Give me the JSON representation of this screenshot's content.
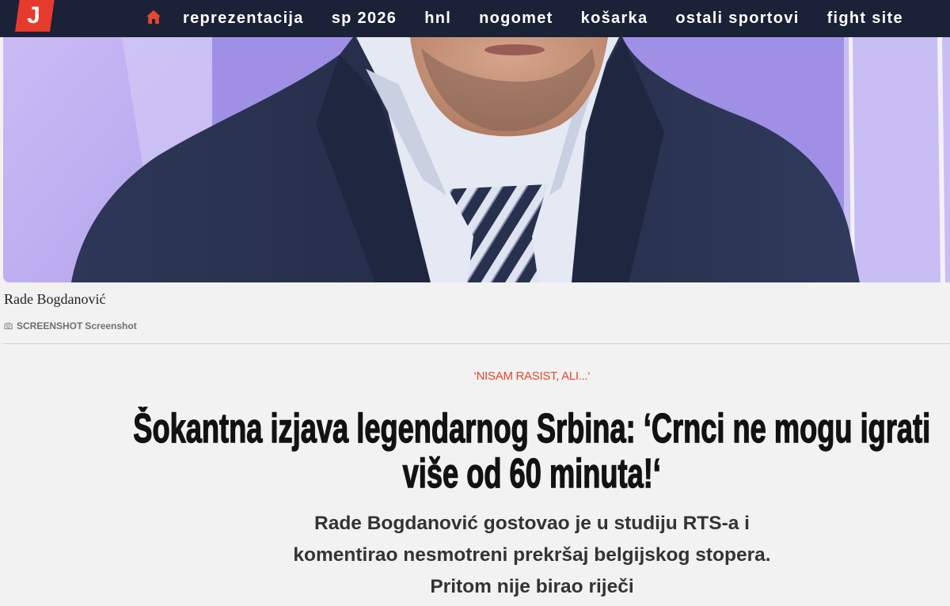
{
  "brand": {
    "logo_letter": "J",
    "logo_color": "#e63a2c",
    "nav_background": "#1b2137",
    "accent": "#e4472e"
  },
  "nav": {
    "home_icon": "home-icon",
    "items": [
      {
        "label": "reprezentacija"
      },
      {
        "label": "sp 2026"
      },
      {
        "label": "hnl"
      },
      {
        "label": "nogomet"
      },
      {
        "label": "košarka"
      },
      {
        "label": "ostali sportovi"
      },
      {
        "label": "fight site"
      }
    ]
  },
  "hero": {
    "caption": "Rade Bogdanović",
    "credit_icon": "camera-icon",
    "credit_source": "SCREENSHOT",
    "credit_type": "Screenshot"
  },
  "article": {
    "kicker": "‘NISAM RASIST, ALI...‘",
    "kicker_color": "#e4472e",
    "headline": "Šokantna izjava legendarnog Srbina: ‘Crnci ne mogu igrati više od 60 minuta!‘",
    "lead": "Rade Bogdanović gostovao je u studiju RTS-a i komentirao nesmotreni prekršaj belgijskog stopera. Pritom nije birao riječi"
  }
}
